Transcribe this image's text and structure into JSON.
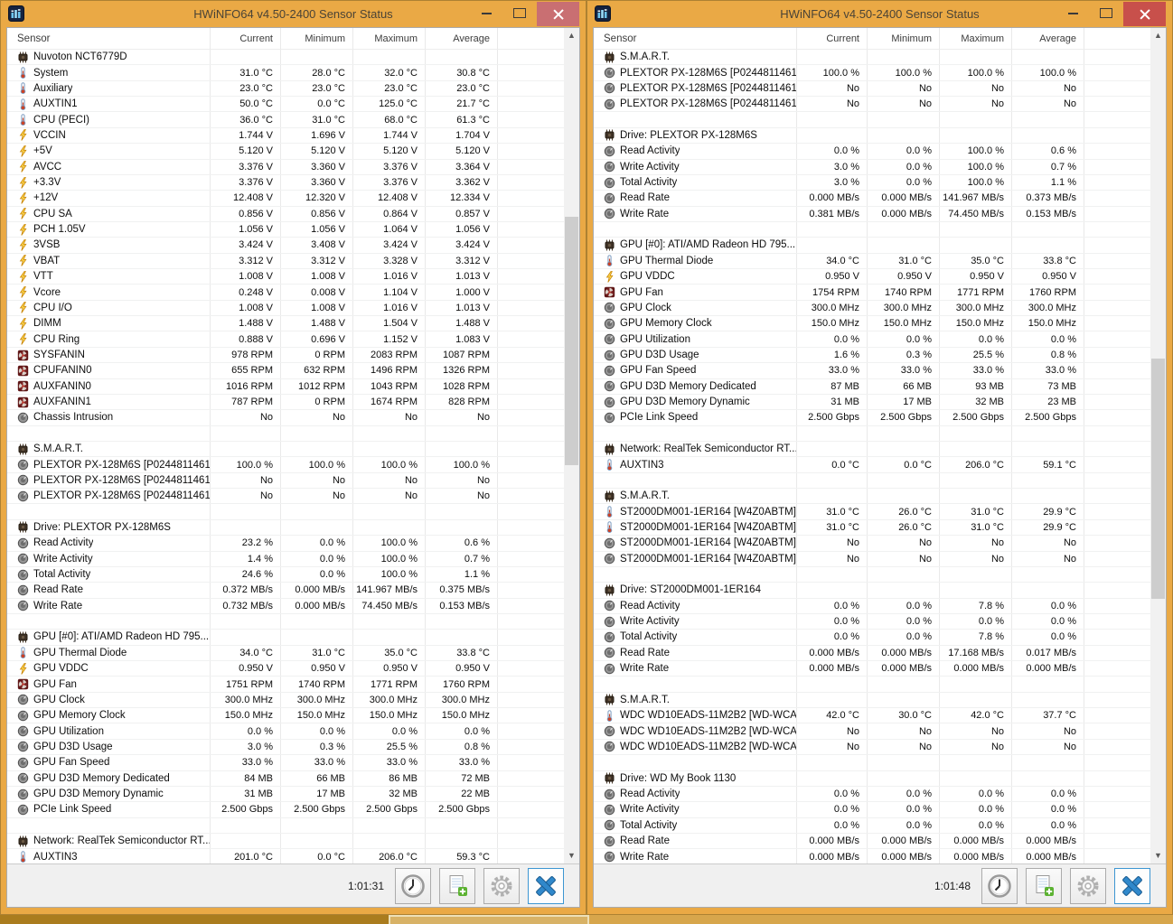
{
  "colors": {
    "titlebar_amber": "#eaa945",
    "close_left": "#c96f72",
    "close_right": "#c8504b",
    "footer_bg": "#f0f0f0",
    "blue_x": "#3088cb",
    "thumb": "#cdcdcd"
  },
  "left_window": {
    "title": "HWiNFO64 v4.50-2400 Sensor Status",
    "columns": [
      "Sensor",
      "Current",
      "Minimum",
      "Maximum",
      "Average"
    ],
    "status_time": "1:01:31",
    "rows": [
      {
        "t": "h",
        "i": "chip",
        "l": "Nuvoton NCT6779D"
      },
      {
        "t": "d",
        "i": "temp",
        "l": "System",
        "v": [
          "31.0 °C",
          "28.0 °C",
          "32.0 °C",
          "30.8 °C"
        ]
      },
      {
        "t": "d",
        "i": "temp",
        "l": "Auxiliary",
        "v": [
          "23.0 °C",
          "23.0 °C",
          "23.0 °C",
          "23.0 °C"
        ]
      },
      {
        "t": "d",
        "i": "temp",
        "l": "AUXTIN1",
        "v": [
          "50.0 °C",
          "0.0 °C",
          "125.0 °C",
          "21.7 °C"
        ]
      },
      {
        "t": "d",
        "i": "temp",
        "l": "CPU (PECI)",
        "v": [
          "36.0 °C",
          "31.0 °C",
          "68.0 °C",
          "61.3 °C"
        ]
      },
      {
        "t": "d",
        "i": "volt",
        "l": "VCCIN",
        "v": [
          "1.744 V",
          "1.696 V",
          "1.744 V",
          "1.704 V"
        ]
      },
      {
        "t": "d",
        "i": "volt",
        "l": "+5V",
        "v": [
          "5.120 V",
          "5.120 V",
          "5.120 V",
          "5.120 V"
        ]
      },
      {
        "t": "d",
        "i": "volt",
        "l": "AVCC",
        "v": [
          "3.376 V",
          "3.360 V",
          "3.376 V",
          "3.364 V"
        ]
      },
      {
        "t": "d",
        "i": "volt",
        "l": "+3.3V",
        "v": [
          "3.376 V",
          "3.360 V",
          "3.376 V",
          "3.362 V"
        ]
      },
      {
        "t": "d",
        "i": "volt",
        "l": "+12V",
        "v": [
          "12.408 V",
          "12.320 V",
          "12.408 V",
          "12.334 V"
        ]
      },
      {
        "t": "d",
        "i": "volt",
        "l": "CPU SA",
        "v": [
          "0.856 V",
          "0.856 V",
          "0.864 V",
          "0.857 V"
        ]
      },
      {
        "t": "d",
        "i": "volt",
        "l": "PCH 1.05V",
        "v": [
          "1.056 V",
          "1.056 V",
          "1.064 V",
          "1.056 V"
        ]
      },
      {
        "t": "d",
        "i": "volt",
        "l": "3VSB",
        "v": [
          "3.424 V",
          "3.408 V",
          "3.424 V",
          "3.424 V"
        ]
      },
      {
        "t": "d",
        "i": "volt",
        "l": "VBAT",
        "v": [
          "3.312 V",
          "3.312 V",
          "3.328 V",
          "3.312 V"
        ]
      },
      {
        "t": "d",
        "i": "volt",
        "l": "VTT",
        "v": [
          "1.008 V",
          "1.008 V",
          "1.016 V",
          "1.013 V"
        ]
      },
      {
        "t": "d",
        "i": "volt",
        "l": "Vcore",
        "v": [
          "0.248 V",
          "0.008 V",
          "1.104 V",
          "1.000 V"
        ]
      },
      {
        "t": "d",
        "i": "volt",
        "l": "CPU I/O",
        "v": [
          "1.008 V",
          "1.008 V",
          "1.016 V",
          "1.013 V"
        ]
      },
      {
        "t": "d",
        "i": "volt",
        "l": "DIMM",
        "v": [
          "1.488 V",
          "1.488 V",
          "1.504 V",
          "1.488 V"
        ]
      },
      {
        "t": "d",
        "i": "volt",
        "l": "CPU Ring",
        "v": [
          "0.888 V",
          "0.696 V",
          "1.152 V",
          "1.083 V"
        ]
      },
      {
        "t": "d",
        "i": "fan",
        "l": "SYSFANIN",
        "v": [
          "978 RPM",
          "0 RPM",
          "2083 RPM",
          "1087 RPM"
        ]
      },
      {
        "t": "d",
        "i": "fan",
        "l": "CPUFANIN0",
        "v": [
          "655 RPM",
          "632 RPM",
          "1496 RPM",
          "1326 RPM"
        ]
      },
      {
        "t": "d",
        "i": "fan",
        "l": "AUXFANIN0",
        "v": [
          "1016 RPM",
          "1012 RPM",
          "1043 RPM",
          "1028 RPM"
        ]
      },
      {
        "t": "d",
        "i": "fan",
        "l": "AUXFANIN1",
        "v": [
          "787 RPM",
          "0 RPM",
          "1674 RPM",
          "828 RPM"
        ]
      },
      {
        "t": "d",
        "i": "gauge",
        "l": "Chassis Intrusion",
        "v": [
          "No",
          "No",
          "No",
          "No"
        ]
      },
      {
        "t": "s"
      },
      {
        "t": "h",
        "i": "chip",
        "l": "S.M.A.R.T."
      },
      {
        "t": "d",
        "i": "gauge",
        "l": "PLEXTOR PX-128M6S [P0244811461...",
        "v": [
          "100.0 %",
          "100.0 %",
          "100.0 %",
          "100.0 %"
        ]
      },
      {
        "t": "d",
        "i": "gauge",
        "l": "PLEXTOR PX-128M6S [P0244811461...",
        "v": [
          "No",
          "No",
          "No",
          "No"
        ]
      },
      {
        "t": "d",
        "i": "gauge",
        "l": "PLEXTOR PX-128M6S [P0244811461...",
        "v": [
          "No",
          "No",
          "No",
          "No"
        ]
      },
      {
        "t": "s"
      },
      {
        "t": "h",
        "i": "chip",
        "l": "Drive: PLEXTOR PX-128M6S"
      },
      {
        "t": "d",
        "i": "gauge",
        "l": "Read Activity",
        "v": [
          "23.2 %",
          "0.0 %",
          "100.0 %",
          "0.6 %"
        ]
      },
      {
        "t": "d",
        "i": "gauge",
        "l": "Write Activity",
        "v": [
          "1.4 %",
          "0.0 %",
          "100.0 %",
          "0.7 %"
        ]
      },
      {
        "t": "d",
        "i": "gauge",
        "l": "Total Activity",
        "v": [
          "24.6 %",
          "0.0 %",
          "100.0 %",
          "1.1 %"
        ]
      },
      {
        "t": "d",
        "i": "gauge",
        "l": "Read Rate",
        "v": [
          "0.372 MB/s",
          "0.000 MB/s",
          "141.967 MB/s",
          "0.375 MB/s"
        ]
      },
      {
        "t": "d",
        "i": "gauge",
        "l": "Write Rate",
        "v": [
          "0.732 MB/s",
          "0.000 MB/s",
          "74.450 MB/s",
          "0.153 MB/s"
        ]
      },
      {
        "t": "s"
      },
      {
        "t": "h",
        "i": "chip",
        "l": "GPU [#0]: ATI/AMD Radeon HD 795..."
      },
      {
        "t": "d",
        "i": "temp",
        "l": "GPU Thermal Diode",
        "v": [
          "34.0 °C",
          "31.0 °C",
          "35.0 °C",
          "33.8 °C"
        ]
      },
      {
        "t": "d",
        "i": "volt",
        "l": "GPU VDDC",
        "v": [
          "0.950 V",
          "0.950 V",
          "0.950 V",
          "0.950 V"
        ]
      },
      {
        "t": "d",
        "i": "fan",
        "l": "GPU Fan",
        "v": [
          "1751 RPM",
          "1740 RPM",
          "1771 RPM",
          "1760 RPM"
        ]
      },
      {
        "t": "d",
        "i": "gauge",
        "l": "GPU Clock",
        "v": [
          "300.0 MHz",
          "300.0 MHz",
          "300.0 MHz",
          "300.0 MHz"
        ]
      },
      {
        "t": "d",
        "i": "gauge",
        "l": "GPU Memory Clock",
        "v": [
          "150.0 MHz",
          "150.0 MHz",
          "150.0 MHz",
          "150.0 MHz"
        ]
      },
      {
        "t": "d",
        "i": "gauge",
        "l": "GPU Utilization",
        "v": [
          "0.0 %",
          "0.0 %",
          "0.0 %",
          "0.0 %"
        ]
      },
      {
        "t": "d",
        "i": "gauge",
        "l": "GPU D3D Usage",
        "v": [
          "3.0 %",
          "0.3 %",
          "25.5 %",
          "0.8 %"
        ]
      },
      {
        "t": "d",
        "i": "gauge",
        "l": "GPU Fan Speed",
        "v": [
          "33.0 %",
          "33.0 %",
          "33.0 %",
          "33.0 %"
        ]
      },
      {
        "t": "d",
        "i": "gauge",
        "l": "GPU D3D Memory Dedicated",
        "v": [
          "84 MB",
          "66 MB",
          "86 MB",
          "72 MB"
        ]
      },
      {
        "t": "d",
        "i": "gauge",
        "l": "GPU D3D Memory Dynamic",
        "v": [
          "31 MB",
          "17 MB",
          "32 MB",
          "22 MB"
        ]
      },
      {
        "t": "d",
        "i": "gauge",
        "l": "PCIe Link Speed",
        "v": [
          "2.500 Gbps",
          "2.500 Gbps",
          "2.500 Gbps",
          "2.500 Gbps"
        ]
      },
      {
        "t": "s"
      },
      {
        "t": "h",
        "i": "chip",
        "l": "Network: RealTek Semiconductor RT..."
      },
      {
        "t": "d",
        "i": "temp",
        "l": "AUXTIN3",
        "v": [
          "201.0 °C",
          "0.0 °C",
          "206.0 °C",
          "59.3 °C"
        ]
      }
    ]
  },
  "right_window": {
    "title": "HWiNFO64 v4.50-2400 Sensor Status",
    "columns": [
      "Sensor",
      "Current",
      "Minimum",
      "Maximum",
      "Average"
    ],
    "status_time": "1:01:48",
    "rows": [
      {
        "t": "h",
        "i": "chip",
        "l": "S.M.A.R.T."
      },
      {
        "t": "d",
        "i": "gauge",
        "l": "PLEXTOR PX-128M6S [P0244811461...",
        "v": [
          "100.0 %",
          "100.0 %",
          "100.0 %",
          "100.0 %"
        ]
      },
      {
        "t": "d",
        "i": "gauge",
        "l": "PLEXTOR PX-128M6S [P0244811461...",
        "v": [
          "No",
          "No",
          "No",
          "No"
        ]
      },
      {
        "t": "d",
        "i": "gauge",
        "l": "PLEXTOR PX-128M6S [P0244811461...",
        "v": [
          "No",
          "No",
          "No",
          "No"
        ]
      },
      {
        "t": "s"
      },
      {
        "t": "h",
        "i": "chip",
        "l": "Drive: PLEXTOR PX-128M6S"
      },
      {
        "t": "d",
        "i": "gauge",
        "l": "Read Activity",
        "v": [
          "0.0 %",
          "0.0 %",
          "100.0 %",
          "0.6 %"
        ]
      },
      {
        "t": "d",
        "i": "gauge",
        "l": "Write Activity",
        "v": [
          "3.0 %",
          "0.0 %",
          "100.0 %",
          "0.7 %"
        ]
      },
      {
        "t": "d",
        "i": "gauge",
        "l": "Total Activity",
        "v": [
          "3.0 %",
          "0.0 %",
          "100.0 %",
          "1.1 %"
        ]
      },
      {
        "t": "d",
        "i": "gauge",
        "l": "Read Rate",
        "v": [
          "0.000 MB/s",
          "0.000 MB/s",
          "141.967 MB/s",
          "0.373 MB/s"
        ]
      },
      {
        "t": "d",
        "i": "gauge",
        "l": "Write Rate",
        "v": [
          "0.381 MB/s",
          "0.000 MB/s",
          "74.450 MB/s",
          "0.153 MB/s"
        ]
      },
      {
        "t": "s"
      },
      {
        "t": "h",
        "i": "chip",
        "l": "GPU [#0]: ATI/AMD Radeon HD 795..."
      },
      {
        "t": "d",
        "i": "temp",
        "l": "GPU Thermal Diode",
        "v": [
          "34.0 °C",
          "31.0 °C",
          "35.0 °C",
          "33.8 °C"
        ]
      },
      {
        "t": "d",
        "i": "volt",
        "l": "GPU VDDC",
        "v": [
          "0.950 V",
          "0.950 V",
          "0.950 V",
          "0.950 V"
        ]
      },
      {
        "t": "d",
        "i": "fan",
        "l": "GPU Fan",
        "v": [
          "1754 RPM",
          "1740 RPM",
          "1771 RPM",
          "1760 RPM"
        ]
      },
      {
        "t": "d",
        "i": "gauge",
        "l": "GPU Clock",
        "v": [
          "300.0 MHz",
          "300.0 MHz",
          "300.0 MHz",
          "300.0 MHz"
        ]
      },
      {
        "t": "d",
        "i": "gauge",
        "l": "GPU Memory Clock",
        "v": [
          "150.0 MHz",
          "150.0 MHz",
          "150.0 MHz",
          "150.0 MHz"
        ]
      },
      {
        "t": "d",
        "i": "gauge",
        "l": "GPU Utilization",
        "v": [
          "0.0 %",
          "0.0 %",
          "0.0 %",
          "0.0 %"
        ]
      },
      {
        "t": "d",
        "i": "gauge",
        "l": "GPU D3D Usage",
        "v": [
          "1.6 %",
          "0.3 %",
          "25.5 %",
          "0.8 %"
        ]
      },
      {
        "t": "d",
        "i": "gauge",
        "l": "GPU Fan Speed",
        "v": [
          "33.0 %",
          "33.0 %",
          "33.0 %",
          "33.0 %"
        ]
      },
      {
        "t": "d",
        "i": "gauge",
        "l": "GPU D3D Memory Dedicated",
        "v": [
          "87 MB",
          "66 MB",
          "93 MB",
          "73 MB"
        ]
      },
      {
        "t": "d",
        "i": "gauge",
        "l": "GPU D3D Memory Dynamic",
        "v": [
          "31 MB",
          "17 MB",
          "32 MB",
          "23 MB"
        ]
      },
      {
        "t": "d",
        "i": "gauge",
        "l": "PCIe Link Speed",
        "v": [
          "2.500 Gbps",
          "2.500 Gbps",
          "2.500 Gbps",
          "2.500 Gbps"
        ]
      },
      {
        "t": "s"
      },
      {
        "t": "h",
        "i": "chip",
        "l": "Network: RealTek Semiconductor RT..."
      },
      {
        "t": "d",
        "i": "temp",
        "l": "AUXTIN3",
        "v": [
          "0.0 °C",
          "0.0 °C",
          "206.0 °C",
          "59.1 °C"
        ]
      },
      {
        "t": "s"
      },
      {
        "t": "h",
        "i": "chip",
        "l": "S.M.A.R.T."
      },
      {
        "t": "d",
        "i": "temp",
        "l": "ST2000DM001-1ER164 [W4Z0ABTM]",
        "v": [
          "31.0 °C",
          "26.0 °C",
          "31.0 °C",
          "29.9 °C"
        ]
      },
      {
        "t": "d",
        "i": "temp",
        "l": "ST2000DM001-1ER164 [W4Z0ABTM]...",
        "v": [
          "31.0 °C",
          "26.0 °C",
          "31.0 °C",
          "29.9 °C"
        ]
      },
      {
        "t": "d",
        "i": "gauge",
        "l": "ST2000DM001-1ER164 [W4Z0ABTM]...",
        "v": [
          "No",
          "No",
          "No",
          "No"
        ]
      },
      {
        "t": "d",
        "i": "gauge",
        "l": "ST2000DM001-1ER164 [W4Z0ABTM]...",
        "v": [
          "No",
          "No",
          "No",
          "No"
        ]
      },
      {
        "t": "s"
      },
      {
        "t": "h",
        "i": "chip",
        "l": "Drive: ST2000DM001-1ER164"
      },
      {
        "t": "d",
        "i": "gauge",
        "l": "Read Activity",
        "v": [
          "0.0 %",
          "0.0 %",
          "7.8 %",
          "0.0 %"
        ]
      },
      {
        "t": "d",
        "i": "gauge",
        "l": "Write Activity",
        "v": [
          "0.0 %",
          "0.0 %",
          "0.0 %",
          "0.0 %"
        ]
      },
      {
        "t": "d",
        "i": "gauge",
        "l": "Total Activity",
        "v": [
          "0.0 %",
          "0.0 %",
          "7.8 %",
          "0.0 %"
        ]
      },
      {
        "t": "d",
        "i": "gauge",
        "l": "Read Rate",
        "v": [
          "0.000 MB/s",
          "0.000 MB/s",
          "17.168 MB/s",
          "0.017 MB/s"
        ]
      },
      {
        "t": "d",
        "i": "gauge",
        "l": "Write Rate",
        "v": [
          "0.000 MB/s",
          "0.000 MB/s",
          "0.000 MB/s",
          "0.000 MB/s"
        ]
      },
      {
        "t": "s"
      },
      {
        "t": "h",
        "i": "chip",
        "l": "S.M.A.R.T."
      },
      {
        "t": "d",
        "i": "temp",
        "l": "WDC WD10EADS-11M2B2 [WD-WCA...",
        "v": [
          "42.0 °C",
          "30.0 °C",
          "42.0 °C",
          "37.7 °C"
        ]
      },
      {
        "t": "d",
        "i": "gauge",
        "l": "WDC WD10EADS-11M2B2 [WD-WCA...",
        "v": [
          "No",
          "No",
          "No",
          "No"
        ]
      },
      {
        "t": "d",
        "i": "gauge",
        "l": "WDC WD10EADS-11M2B2 [WD-WCA...",
        "v": [
          "No",
          "No",
          "No",
          "No"
        ]
      },
      {
        "t": "s"
      },
      {
        "t": "h",
        "i": "chip",
        "l": "Drive: WD My Book 1130"
      },
      {
        "t": "d",
        "i": "gauge",
        "l": "Read Activity",
        "v": [
          "0.0 %",
          "0.0 %",
          "0.0 %",
          "0.0 %"
        ]
      },
      {
        "t": "d",
        "i": "gauge",
        "l": "Write Activity",
        "v": [
          "0.0 %",
          "0.0 %",
          "0.0 %",
          "0.0 %"
        ]
      },
      {
        "t": "d",
        "i": "gauge",
        "l": "Total Activity",
        "v": [
          "0.0 %",
          "0.0 %",
          "0.0 %",
          "0.0 %"
        ]
      },
      {
        "t": "d",
        "i": "gauge",
        "l": "Read Rate",
        "v": [
          "0.000 MB/s",
          "0.000 MB/s",
          "0.000 MB/s",
          "0.000 MB/s"
        ]
      },
      {
        "t": "d",
        "i": "gauge",
        "l": "Write Rate",
        "v": [
          "0.000 MB/s",
          "0.000 MB/s",
          "0.000 MB/s",
          "0.000 MB/s"
        ]
      }
    ]
  }
}
